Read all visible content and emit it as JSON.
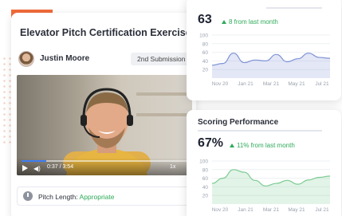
{
  "exercise": {
    "title": "Elevator Pitch Certification Exercise",
    "user_name": "Justin Moore",
    "submission": "2nd Submission",
    "video": {
      "time": "0:37 / 3:54",
      "speed": "1x",
      "progress": 0.15
    },
    "pitch_length": {
      "label": "Pitch Length:",
      "value": "Appropriate"
    }
  },
  "colors": {
    "accent": "#f26b3a",
    "positive": "#2eaa5a",
    "chart1": "#7f93d6",
    "chart2": "#7ccb93"
  },
  "icons": {
    "play": "play-icon",
    "volume": "volume-icon",
    "clock": "clock-icon"
  },
  "metrics": [
    {
      "title": "",
      "value": "63",
      "delta": "8 from last month",
      "chart_data": {
        "type": "area",
        "x": [
          "Nov 20",
          "Jan 21",
          "Mar 21",
          "May 21",
          "Jul 21"
        ],
        "y": [
          30,
          34,
          58,
          36,
          42,
          40,
          55,
          38,
          45,
          58,
          48,
          46
        ],
        "yticks": [
          "100",
          "80",
          "60",
          "40",
          "20"
        ],
        "ylim": [
          0,
          100
        ]
      }
    },
    {
      "title": "Scoring Performance",
      "value": "67%",
      "delta": "11% from last month",
      "chart_data": {
        "type": "area",
        "x": [
          "Nov 20",
          "Jan 21",
          "Mar 21",
          "May 21",
          "Jul 21"
        ],
        "y": [
          48,
          60,
          80,
          74,
          55,
          42,
          48,
          55,
          46,
          56,
          62,
          65
        ],
        "yticks": [
          "100",
          "80",
          "60",
          "40",
          "20"
        ],
        "ylim": [
          0,
          100
        ]
      }
    }
  ]
}
